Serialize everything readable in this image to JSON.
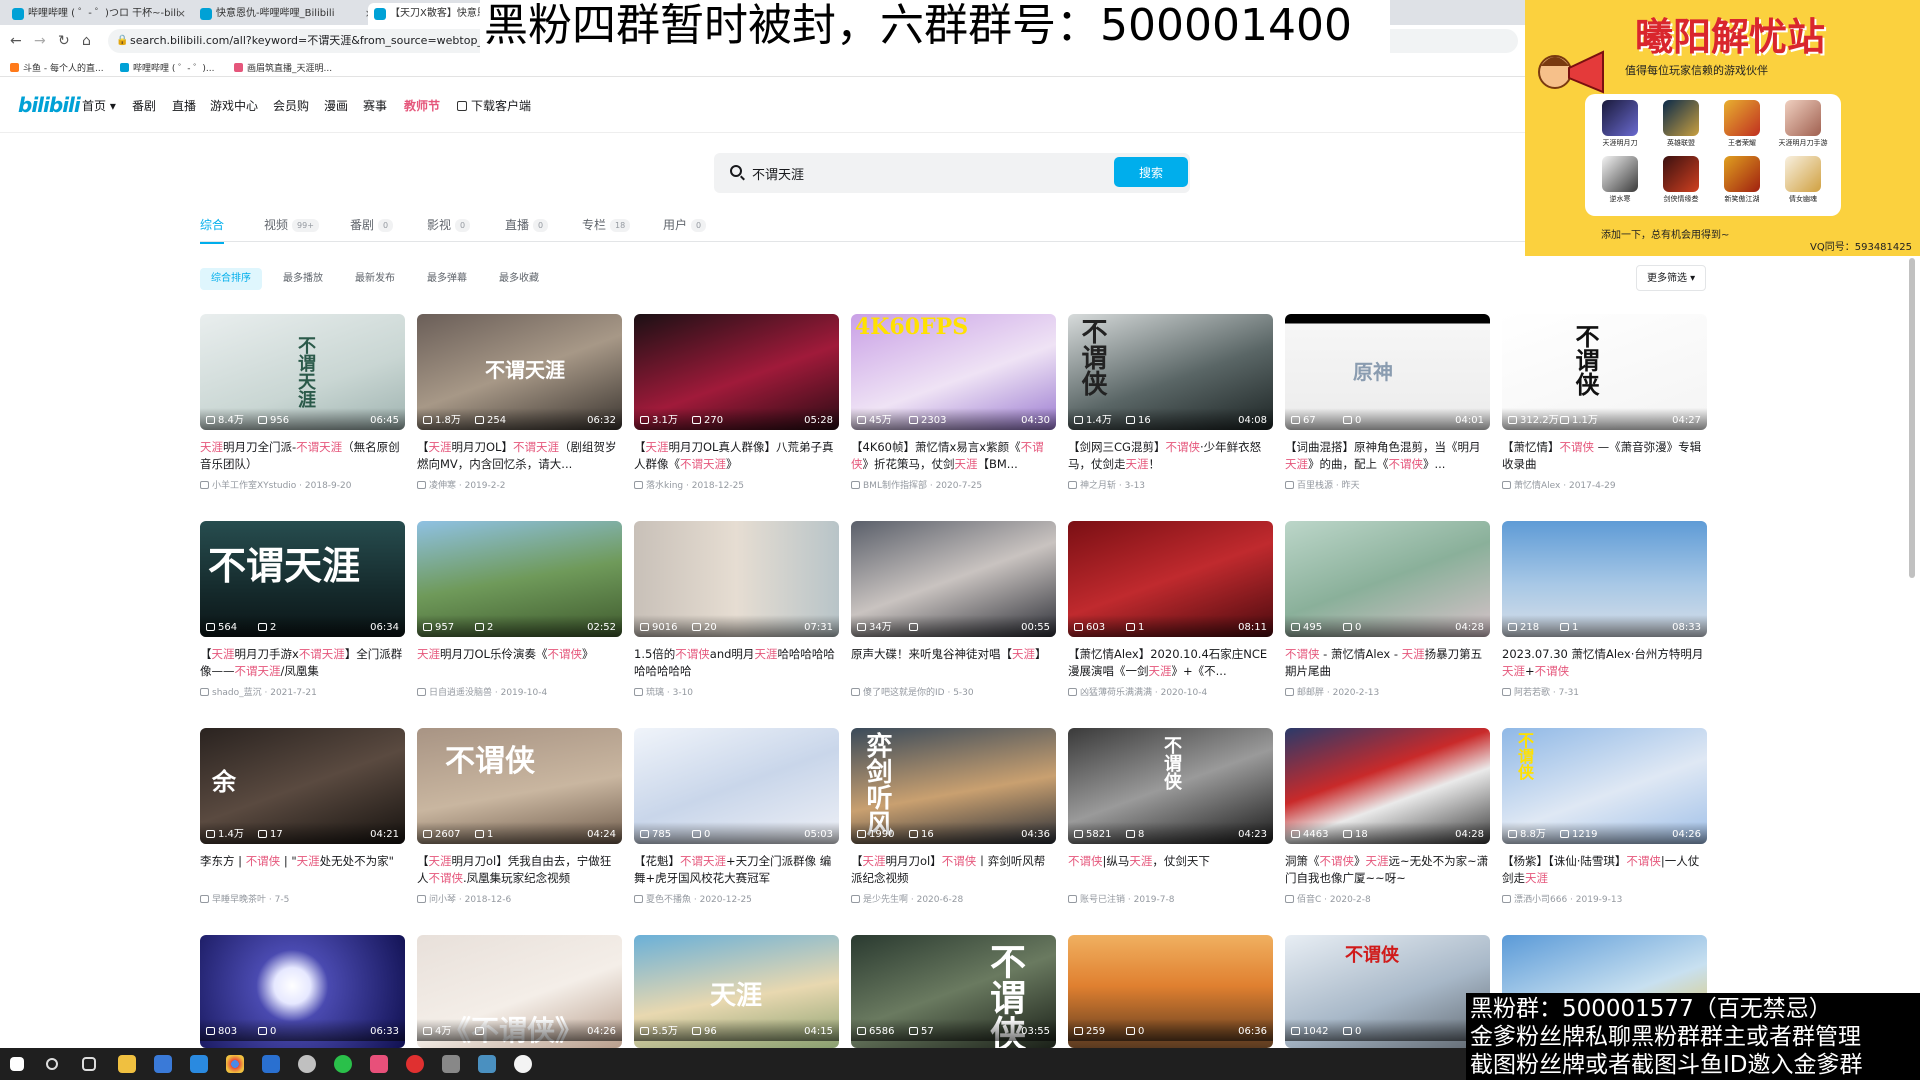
{
  "browser": {
    "tabs": [
      {
        "label": "哔哩哔哩 ( ゜- ゜)つロ 干杯~-bili",
        "active": false
      },
      {
        "label": "快意恩仇-哔哩哔哩_Bilibili",
        "active": false
      },
      {
        "label": "【天刀X散客】快意恩仇...",
        "active": true
      }
    ],
    "close_glyph": "×",
    "url": "search.bilibili.com/all?keyword=不谓天涯&from_source=webtop_search",
    "lock_glyph": "🔒",
    "back_glyph": "←",
    "forward_glyph": "→",
    "reload_glyph": "↻",
    "home_glyph": "⌂",
    "bookmarks": [
      "斗鱼 - 每个人的直...",
      "哔哩哔哩 ( ゜- ゜)...",
      "画眉筑直播_天涯明..."
    ]
  },
  "header": {
    "logo": "bilibili",
    "nav": [
      {
        "label": "首页 ▾",
        "highlight": false
      },
      {
        "label": "番剧",
        "highlight": false
      },
      {
        "label": "直播",
        "highlight": false
      },
      {
        "label": "游戏中心",
        "highlight": false
      },
      {
        "label": "会员购",
        "highlight": false
      },
      {
        "label": "漫画",
        "highlight": false
      },
      {
        "label": "赛事",
        "highlight": false
      },
      {
        "label": "教师节",
        "highlight": true
      }
    ],
    "download": "下载客户端"
  },
  "search": {
    "value": "不谓天涯",
    "button": "搜索"
  },
  "category_tabs": [
    {
      "label": "综合",
      "count": "",
      "active": true
    },
    {
      "label": "视频",
      "count": "99+",
      "active": false
    },
    {
      "label": "番剧",
      "count": "0",
      "active": false
    },
    {
      "label": "影视",
      "count": "0",
      "active": false
    },
    {
      "label": "直播",
      "count": "0",
      "active": false
    },
    {
      "label": "专栏",
      "count": "18",
      "active": false
    },
    {
      "label": "用户",
      "count": "0",
      "active": false
    }
  ],
  "sort": {
    "options": [
      {
        "label": "综合排序",
        "active": true
      },
      {
        "label": "最多播放",
        "active": false
      },
      {
        "label": "最新发布",
        "active": false
      },
      {
        "label": "最多弹幕",
        "active": false
      },
      {
        "label": "最多收藏",
        "active": false
      }
    ],
    "more_filter": "更多筛选 ▾"
  },
  "videos": [
    {
      "views": "8.4万",
      "danmu": "956",
      "duration": "06:45",
      "title": "天涯明月刀全门派-不谓天涯（無名原创音乐团队）",
      "author": "小羊工作室XYstudio",
      "date": "2018-9-20",
      "bg": "linear-gradient(160deg,#e9eeee,#c9d6d3 60%,#9fb3b0)",
      "thumb_text": "不谓天涯",
      "tt_color": "#2b5a4a"
    },
    {
      "views": "1.8万",
      "danmu": "254",
      "duration": "06:32",
      "title": "【天涯明月刀OL】不谓天涯（剧组贺岁燃向MV，内含回忆杀，请大...",
      "author": "凌伸寒",
      "date": "2019-2-2",
      "bg": "linear-gradient(160deg,#6a5e58,#a79887 50%,#3b3530)",
      "thumb_text": "不谓天涯",
      "tt_color": "#ffffff"
    },
    {
      "views": "3.1万",
      "danmu": "270",
      "duration": "05:28",
      "title": "【天涯明月刀OL真人群像】八荒弟子真人群像《不谓天涯》",
      "author": "落水king",
      "date": "2018-12-25",
      "bg": "linear-gradient(160deg,#1b1014,#a01a3a 55%,#2a0c14)",
      "thumb_text": "",
      "tt_color": "#ffffff"
    },
    {
      "views": "45万",
      "danmu": "2303",
      "duration": "04:30",
      "title": "【4K60帧】萧忆情x易言x紫颜《不谓侠》折花策马，仗剑天涯【BM...",
      "author": "BML制作指挥部",
      "date": "2020-7-25",
      "bg": "linear-gradient(160deg,#c9a0e6,#efe3f5 55%,#9a7ad0)",
      "thumb_text": "4K60FPS",
      "tt_color": "#ffe100"
    },
    {
      "views": "1.4万",
      "danmu": "16",
      "duration": "04:08",
      "title": "【剑网三CG混剪】不谓侠·少年鲜衣怒马，仗剑走天涯！",
      "author": "神之月斩",
      "date": "3-13",
      "bg": "linear-gradient(160deg,#d7dbdb,#5a6666 55%,#1c2424)",
      "thumb_text": "不谓侠",
      "tt_color": "#222222"
    },
    {
      "views": "67",
      "danmu": "0",
      "duration": "04:01",
      "title": "【词曲混搭】原神角色混剪，当《明月天涯》的曲，配上《不谓侠》...",
      "author": "百里栈源",
      "date": "昨天",
      "bg": "linear-gradient(180deg,#000 0,#000 8%,#f6f6f6 8%,#ececec 100%)",
      "thumb_text": "原神",
      "tt_color": "#8a9cb0"
    },
    {
      "views": "312.2万",
      "danmu": "1.1万",
      "duration": "04:27",
      "title": "【萧忆情】不谓侠 —《萧音弥漫》专辑收录曲",
      "author": "萧忆情Alex",
      "date": "2017-4-29",
      "bg": "linear-gradient(160deg,#ffffff,#f4f4f4)",
      "thumb_text": "不谓侠",
      "tt_color": "#111111"
    },
    {
      "views": "564",
      "danmu": "2",
      "duration": "06:34",
      "title": "【天涯明月刀手游x不谓天涯】全门派群像——不谓天涯/凤凰集",
      "author": "shado_蓝沉",
      "date": "2021-7-21",
      "bg": "linear-gradient(180deg,#274d4f,#152a2c 60%,#0b1516)",
      "thumb_text": "不谓天涯",
      "tt_color": "#ffffff"
    },
    {
      "views": "957",
      "danmu": "2",
      "duration": "02:52",
      "title": "天涯明月刀OL乐伶演奏《不谓侠》",
      "author": "日自逍遥没脑兽",
      "date": "2019-10-4",
      "bg": "linear-gradient(170deg,#8fc1e3,#6f9a5a 50%,#3f5a2e)",
      "thumb_text": "",
      "tt_color": "#ffffff"
    },
    {
      "views": "9016",
      "danmu": "20",
      "duration": "07:31",
      "title": "1.5倍的不谓侠and明月天涯哈哈哈哈哈哈哈哈哈哈",
      "author": "琉璃",
      "date": "3-10",
      "bg": "linear-gradient(90deg,#c8c0b8,#e6ddd2 50%,#b8c4c8)",
      "thumb_text": "",
      "tt_color": "#ffffff"
    },
    {
      "views": "34万",
      "danmu": "",
      "duration": "00:55",
      "title": "原声大碟！来听鬼谷神徒对唱【天涯】",
      "author": "傻了吧这就是你的ID",
      "date": "5-30",
      "bg": "linear-gradient(160deg,#5a5f6a,#c9c3c0 50%,#2e3038)",
      "thumb_text": "",
      "tt_color": "#ffffff"
    },
    {
      "views": "603",
      "danmu": "1",
      "duration": "08:11",
      "title": "【萧忆情Alex】2020.10.4石家庄NCE漫展演唱《一剑天涯》+《不...",
      "author": "凶猛薄荷乐满满满",
      "date": "2020-10-4",
      "bg": "linear-gradient(160deg,#7a0f14,#c02a2e 50%,#4a0a0e)",
      "thumb_text": "",
      "tt_color": "#ffffff"
    },
    {
      "views": "495",
      "danmu": "0",
      "duration": "04:28",
      "title": "不谓侠 - 萧忆情Alex - 天涯扬暴刀第五期片尾曲",
      "author": "邮邮胖",
      "date": "2020-2-13",
      "bg": "linear-gradient(160deg,#bcd6c9,#8ab09a 50%,#d7c2c9)",
      "thumb_text": "",
      "tt_color": "#ffffff"
    },
    {
      "views": "218",
      "danmu": "1",
      "duration": "08:33",
      "title": "2023.07.30 萧忆情Alex·台州方特明月天涯+不谓侠",
      "author": "阿若若歌",
      "date": "7-31",
      "bg": "linear-gradient(180deg,#5e9bd6,#a8c8e6 55%,#d8dfe8)",
      "thumb_text": "",
      "tt_color": "#ffffff"
    },
    {
      "views": "1.4万",
      "danmu": "17",
      "duration": "04:21",
      "title": "李东方 | 不谓侠 | \"天涯处无处不为家\"",
      "author": "早睡早晚茶叶",
      "date": "7-5",
      "bg": "linear-gradient(160deg,#2a2320,#5a4a40 50%,#16120f)",
      "thumb_text": "余",
      "tt_color": "#ffffff"
    },
    {
      "views": "2607",
      "danmu": "1",
      "duration": "04:24",
      "title": "【天涯明月刀ol】凭我自由去，宁做狂人不谓侠.凤凰集玩家纪念视频",
      "author": "问小琴",
      "date": "2018-12-6",
      "bg": "linear-gradient(170deg,#a89484,#c9b6a0 55%,#6f5c4c)",
      "thumb_text": "不谓侠",
      "tt_color": "#ffffff"
    },
    {
      "views": "785",
      "danmu": "0",
      "duration": "05:03",
      "title": "【花魁】不谓天涯+天刀全门派群像 编舞+虎牙国风校花大赛冠军",
      "author": "夏色不播魚",
      "date": "2020-12-25",
      "bg": "linear-gradient(160deg,#f0f4fa,#c9d6ea 50%,#eef0f6)",
      "thumb_text": "",
      "tt_color": "#ffffff"
    },
    {
      "views": "1990",
      "danmu": "16",
      "duration": "04:36",
      "title": "【天涯明月刀ol】不谓侠丨弈剑听风帮派纪念视频",
      "author": "是少先生啊",
      "date": "2020-6-28",
      "bg": "linear-gradient(170deg,#3a4a5a,#c9a070 55%,#2a2f38)",
      "thumb_text": "弈剑听风",
      "tt_color": "#ffffff"
    },
    {
      "views": "5821",
      "danmu": "8",
      "duration": "04:23",
      "title": "不谓侠|纵马天涯，仗剑天下",
      "author": "账号已注销",
      "date": "2019-7-8",
      "bg": "linear-gradient(160deg,#3a3a3a,#9a9a9a 50%,#1a1a1a)",
      "thumb_text": "不谓侠",
      "tt_color": "#ffffff"
    },
    {
      "views": "4463",
      "danmu": "18",
      "duration": "04:28",
      "title": "洞箫《不谓侠》天涯远~无处不为家~潇门自我也像广厦~~呀~",
      "author": "佰音C",
      "date": "2020-2-8",
      "bg": "linear-gradient(160deg,#2a3a6a,#c92a2a 40%,#eaeaea 60%,#3a3a3a)",
      "thumb_text": "",
      "tt_color": "#ffffff"
    },
    {
      "views": "8.8万",
      "danmu": "1219",
      "duration": "04:26",
      "title": "【杨紫】【诛仙·陆雪琪】不谓侠|一人仗剑走天涯",
      "author": "漂洒小司666",
      "date": "2019-9-13",
      "bg": "linear-gradient(160deg,#8fb8e6,#dfe8f4 55%,#a0c0e8)",
      "thumb_text": "不谓侠",
      "tt_color": "#ffe100"
    },
    {
      "views": "803",
      "danmu": "0",
      "duration": "06:33",
      "title": "",
      "author": "",
      "date": "",
      "bg": "radial-gradient(circle at 45% 45%,#ffffff 0,#e6e8ff 14%,#4a4ab0 28%,#101050 100%)",
      "thumb_text": "",
      "tt_color": "#ffffff"
    },
    {
      "views": "4万",
      "danmu": "",
      "duration": "04:26",
      "title": "",
      "author": "",
      "date": "",
      "bg": "linear-gradient(160deg,#e8e0da,#f4eee8 55%,#b89e8c)",
      "thumb_text": "《不谓侠》",
      "tt_color": "#ffffff"
    },
    {
      "views": "5.5万",
      "danmu": "96",
      "duration": "04:15",
      "title": "",
      "author": "",
      "date": "",
      "bg": "linear-gradient(170deg,#6ab0d8,#e8d8b0 55%,#8aa070)",
      "thumb_text": "天涯",
      "tt_color": "#ffffff"
    },
    {
      "views": "6586",
      "danmu": "57",
      "duration": "03:55",
      "title": "",
      "author": "",
      "date": "",
      "bg": "linear-gradient(160deg,#2a3a30,#6a7a60 50%,#1a2018)",
      "thumb_text": "不谓侠",
      "tt_color": "#ffffff"
    },
    {
      "views": "259",
      "danmu": "0",
      "duration": "06:36",
      "title": "",
      "author": "",
      "date": "",
      "bg": "linear-gradient(180deg,#f0b060,#e08030 45%,#5a3a20)",
      "thumb_text": "",
      "tt_color": "#ffffff"
    },
    {
      "views": "1042",
      "danmu": "0",
      "duration": "",
      "title": "",
      "author": "",
      "date": "",
      "bg": "linear-gradient(160deg,#e8eef4,#a8b8c8 55%,#606870)",
      "thumb_text": "不谓侠",
      "tt_color": "#d01a1a"
    },
    {
      "views": "",
      "danmu": "",
      "duration": "",
      "title": "",
      "author": "",
      "date": "",
      "bg": "linear-gradient(160deg,#5a9ad8,#c8e0f0 55%,#e8c040)",
      "thumb_text": "",
      "tt_color": "#ffffff"
    }
  ],
  "overlays": {
    "top_banner": "黑粉四群暂时被封，六群群号：500001400",
    "ad": {
      "title": "曦阳解忧站",
      "subtitle": "值得每位玩家信赖的游戏伙伴",
      "games": [
        "天涯明月刀",
        "英雄联盟",
        "王者荣耀",
        "天涯明月刀手游",
        "逆水寒",
        "剑侠情缘叁",
        "新笑傲江湖",
        "倩女幽魂"
      ],
      "footer": "添加一下，总有机会用得到~",
      "qq": "VQ同号：593481425"
    },
    "bottom_lines": [
      "黑粉群：500001577（百无禁忌）",
      "金爹粉丝牌私聊黑粉群群主或者群管理",
      "截图粉丝牌或者截图斗鱼ID邀入金爹群"
    ]
  },
  "colors": {
    "brand": "#00aeec",
    "highlight": "#e5567b",
    "meta": "#9499a0"
  }
}
